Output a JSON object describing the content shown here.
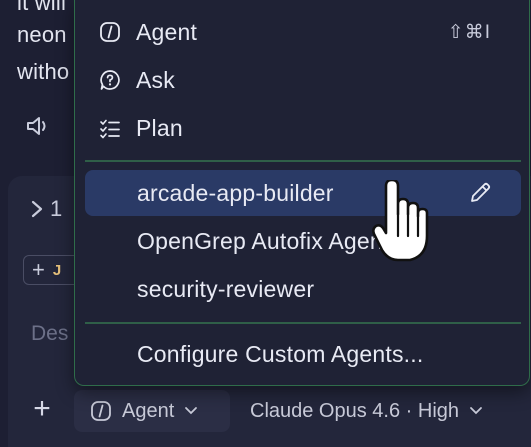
{
  "background": {
    "lines": [
      "it will",
      "neon",
      "witho"
    ]
  },
  "composer": {
    "collapsed_label": "1",
    "chip_letter": "J",
    "placeholder": "Des",
    "add_label": "+",
    "mode_label": "Agent",
    "model_label": "Claude Opus 4.6 · High"
  },
  "menu": {
    "modes": [
      {
        "label": "Agent",
        "icon": "agent-icon",
        "shortcut": "⇧⌘I"
      },
      {
        "label": "Ask",
        "icon": "ask-icon"
      },
      {
        "label": "Plan",
        "icon": "plan-icon"
      }
    ],
    "custom_agents": [
      {
        "label": "arcade-app-builder",
        "selected": true
      },
      {
        "label": "OpenGrep Autofix Agent"
      },
      {
        "label": "security-reviewer"
      }
    ],
    "configure_label": "Configure Custom Agents..."
  },
  "colors": {
    "background": "#1d1f33",
    "menu_background": "#1f2235",
    "menu_border": "#2f6d4a",
    "selected_row": "#2a3a66"
  }
}
